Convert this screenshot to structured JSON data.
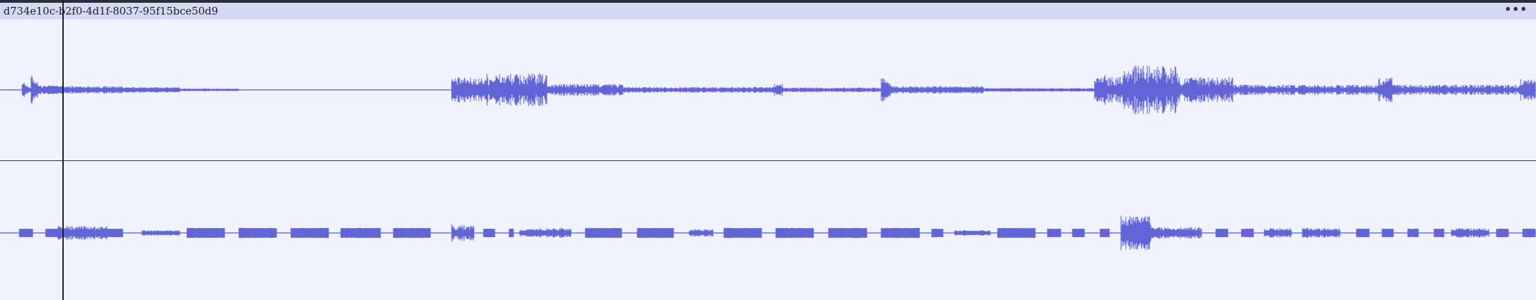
{
  "clip": {
    "name": "d734e10c-b2f0-4d1f-8037-95f15bce50d9",
    "menu_label": "•••"
  },
  "colors": {
    "waveform": "#6365d6",
    "baseline": "#6f72d6",
    "background": "#f0f2fe",
    "header": "#d5d9f3"
  }
}
